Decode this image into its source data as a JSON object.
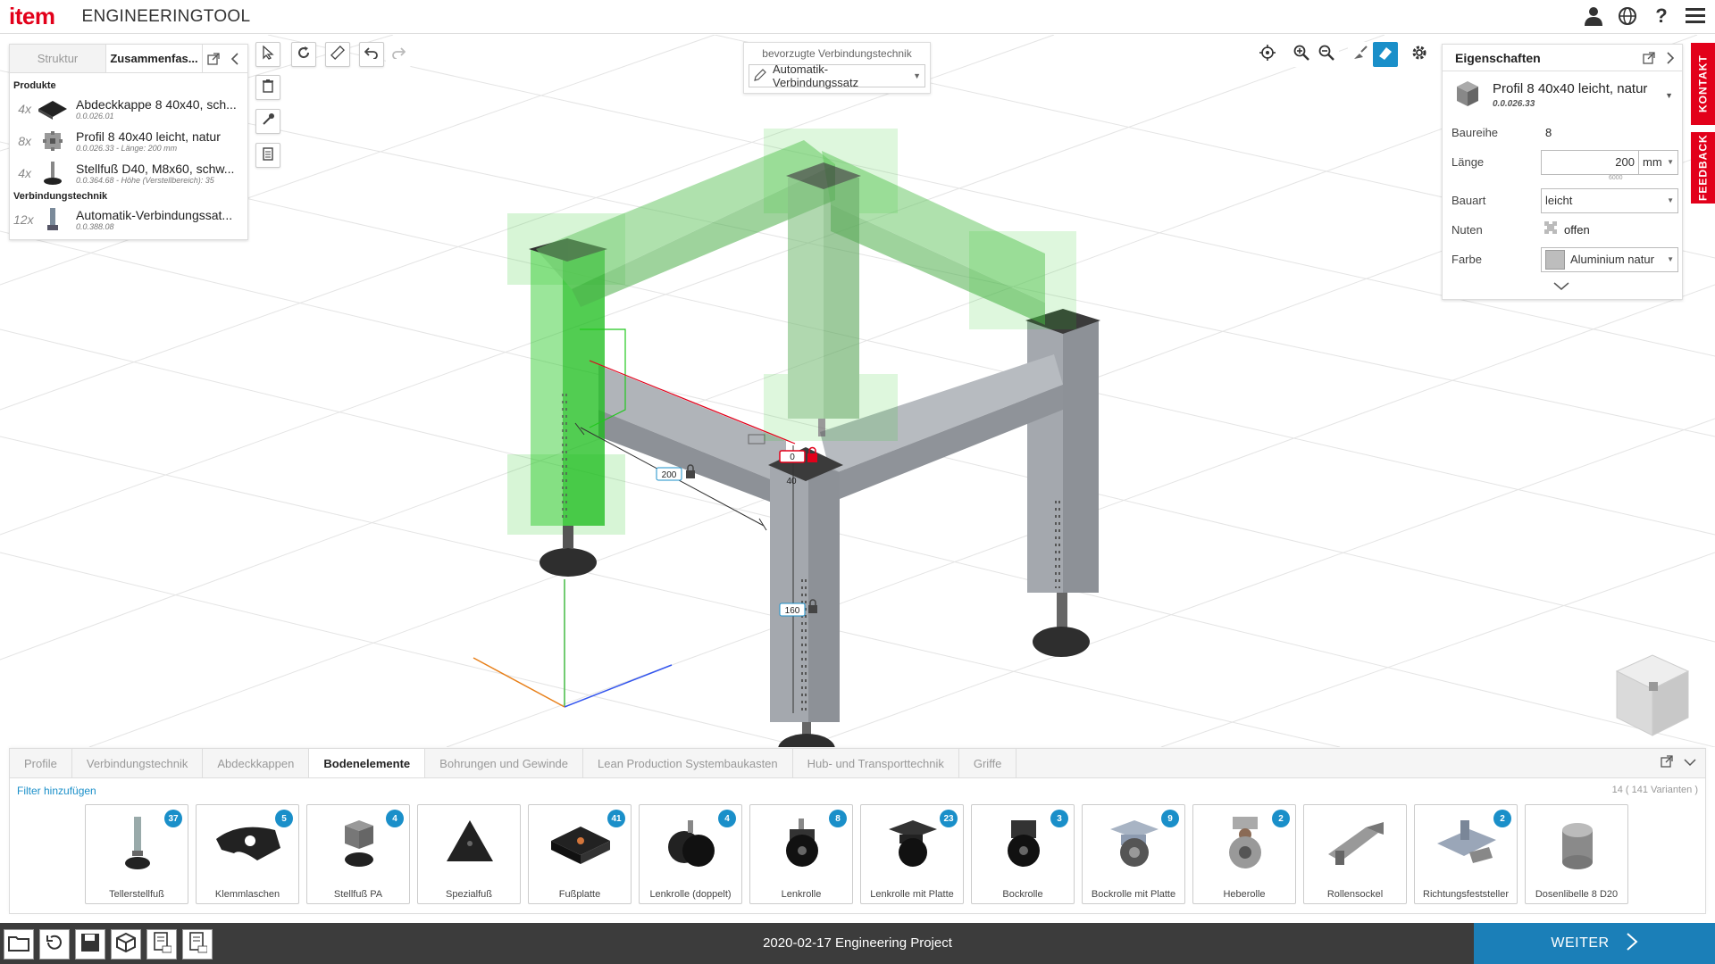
{
  "header": {
    "logo": "item",
    "title": "ENGINEERINGTOOL",
    "icons": [
      "user-icon",
      "language-icon",
      "help-icon",
      "menu-icon"
    ]
  },
  "left_panel": {
    "tabs": [
      {
        "label": "Struktur",
        "active": false
      },
      {
        "label": "Zusammenfas...",
        "active": true
      }
    ],
    "section_products": "Produkte",
    "products": [
      {
        "qty": "4x",
        "name": "Abdeckkappe 8 40x40, sch...",
        "code": "0.0.026.01",
        "icon": "cap-icon"
      },
      {
        "qty": "8x",
        "name": "Profil 8 40x40 leicht, natur",
        "code": "0.0.026.33 - Länge: 200 mm",
        "icon": "profile-icon"
      },
      {
        "qty": "4x",
        "name": "Stellfuß D40, M8x60, schw...",
        "code": "0.0.364.68 - Höhe (Verstellbereich): 35",
        "icon": "foot-icon"
      }
    ],
    "section_connections": "Verbindungstechnik",
    "connections": [
      {
        "qty": "12x",
        "name": "Automatik-Verbindungssat...",
        "code": "0.0.388.08",
        "icon": "connector-icon"
      }
    ]
  },
  "connection_selector": {
    "label": "bevorzugte Verbindungstechnik",
    "value": "Automatik-Verbindungssatz"
  },
  "dimensions": {
    "length_label": "200",
    "height_label": "160",
    "offset_label": "0",
    "small_label": "40"
  },
  "properties": {
    "title": "Eigenschaften",
    "item_name": "Profil 8 40x40 leicht, natur",
    "item_code": "0.0.026.33",
    "rows": {
      "baureihe_label": "Baureihe",
      "baureihe_value": "8",
      "laenge_label": "Länge",
      "laenge_value": "200",
      "laenge_unit": "mm",
      "laenge_max": "6000",
      "bauart_label": "Bauart",
      "bauart_value": "leicht",
      "nuten_label": "Nuten",
      "nuten_value": "offen",
      "farbe_label": "Farbe",
      "farbe_value": "Aluminium natur"
    }
  },
  "side_tabs": {
    "contact": "KONTAKT",
    "feedback": "FEEDBACK"
  },
  "catalog": {
    "tabs": [
      {
        "label": "Profile",
        "active": false
      },
      {
        "label": "Verbindungstechnik",
        "active": false
      },
      {
        "label": "Abdeckkappen",
        "active": false
      },
      {
        "label": "Bodenelemente",
        "active": true
      },
      {
        "label": "Bohrungen und Gewinde",
        "active": false
      },
      {
        "label": "Lean Production Systembaukasten",
        "active": false
      },
      {
        "label": "Hub- und Transporttechnik",
        "active": false
      },
      {
        "label": "Griffe",
        "active": false
      }
    ],
    "filter_link": "Filter hinzufügen",
    "variant_count": "14 ( 141 Varianten )",
    "items": [
      {
        "label": "Tellerstellfuß",
        "badge": "37"
      },
      {
        "label": "Klemmlaschen",
        "badge": "5"
      },
      {
        "label": "Stellfuß PA",
        "badge": "4"
      },
      {
        "label": "Spezialfuß",
        "badge": ""
      },
      {
        "label": "Fußplatte",
        "badge": "41"
      },
      {
        "label": "Lenkrolle (doppelt)",
        "badge": "4"
      },
      {
        "label": "Lenkrolle",
        "badge": "8"
      },
      {
        "label": "Lenkrolle mit Platte",
        "badge": "23"
      },
      {
        "label": "Bockrolle",
        "badge": "3"
      },
      {
        "label": "Bockrolle mit Platte",
        "badge": "9"
      },
      {
        "label": "Heberolle",
        "badge": "2"
      },
      {
        "label": "Rollensockel",
        "badge": ""
      },
      {
        "label": "Richtungsfeststeller",
        "badge": "2"
      },
      {
        "label": "Dosenlibelle 8 D20",
        "badge": ""
      }
    ]
  },
  "bottombar": {
    "project_name": "2020-02-17 Engineering Project",
    "next_label": "WEITER",
    "icons": [
      "folder-icon",
      "history-icon",
      "save-icon",
      "cube-icon",
      "pdf-icon",
      "csv-icon"
    ]
  },
  "colors": {
    "brand_red": "#e2001a",
    "accent_blue": "#1b7fb8",
    "highlight_green": "#22c81e",
    "profile_gray": "#a4a8ae"
  }
}
